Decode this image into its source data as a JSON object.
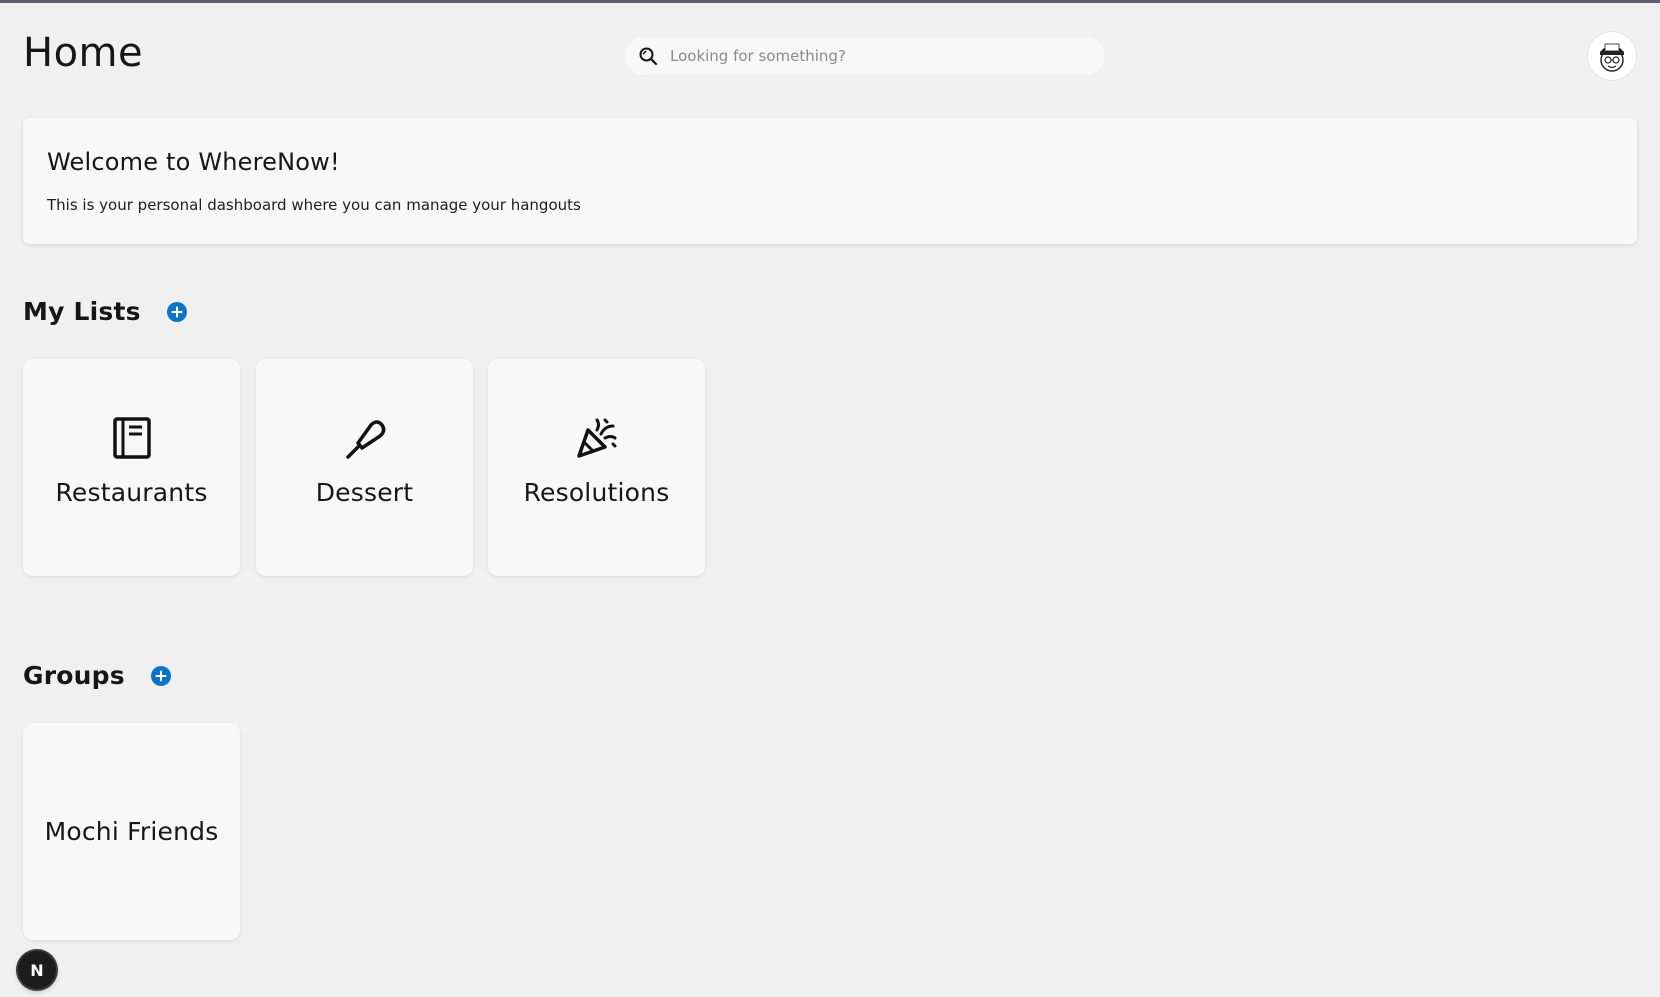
{
  "header": {
    "title": "Home",
    "search": {
      "placeholder": "Looking for something?",
      "value": ""
    },
    "avatar_icon": "user-avatar-icon"
  },
  "welcome": {
    "title": "Welcome to WhereNow!",
    "text": "This is your personal dashboard where you can manage your hangouts"
  },
  "my_lists": {
    "title": "My Lists",
    "add_icon": "plus-circle-icon",
    "items": [
      {
        "label": "Restaurants",
        "icon": "notebook-icon"
      },
      {
        "label": "Dessert",
        "icon": "popsicle-icon"
      },
      {
        "label": "Resolutions",
        "icon": "party-popper-icon"
      }
    ]
  },
  "groups": {
    "title": "Groups",
    "add_icon": "plus-circle-icon",
    "items": [
      {
        "label": "Mochi Friends"
      }
    ]
  },
  "dev_badge": {
    "letter": "N"
  },
  "colors": {
    "background": "#f0f0f0",
    "card": "#f8f8f8",
    "accent": "#0b74c9",
    "text": "#161616"
  }
}
